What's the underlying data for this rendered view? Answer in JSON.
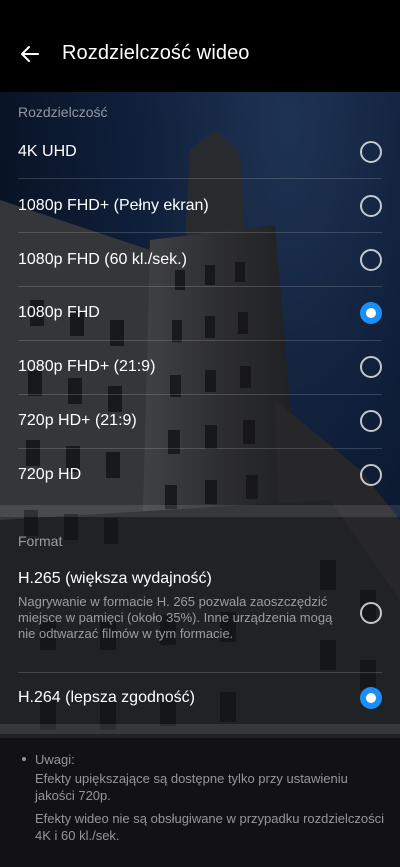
{
  "header": {
    "title": "Rozdzielczość wideo",
    "back_icon": "arrow-left-icon"
  },
  "resolution": {
    "section_label": "Rozdzielczość",
    "options": [
      {
        "label": "4K UHD",
        "selected": false
      },
      {
        "label": "1080p FHD+ (Pełny ekran)",
        "selected": false
      },
      {
        "label": "1080p FHD (60 kl./sek.)",
        "selected": false
      },
      {
        "label": "1080p FHD",
        "selected": true
      },
      {
        "label": "1080p FHD+ (21:9)",
        "selected": false
      },
      {
        "label": "720p HD+ (21:9)",
        "selected": false
      },
      {
        "label": "720p HD",
        "selected": false
      }
    ]
  },
  "format": {
    "section_label": "Format",
    "h265": {
      "label": "H.265 (większa wydajność)",
      "description": "Nagrywanie w formacie H. 265 pozwala zaoszczędzić miejsce w pamięci (około 35%). Inne urządzenia mogą nie odtwarzać filmów w tym formacie.",
      "selected": false
    },
    "h264": {
      "label": "H.264 (lepsza zgodność)",
      "selected": true
    }
  },
  "notes": {
    "title": "Uwagi:",
    "lines": [
      "Efekty upiększające są dostępne tylko przy ustawieniu jakości 720p.",
      "Efekty wideo nie są obsługiwane w przypadku rozdzielczości 4K i 60 kl./sek."
    ]
  },
  "colors": {
    "accent": "#1a8ff7",
    "topbar": "#000000"
  }
}
